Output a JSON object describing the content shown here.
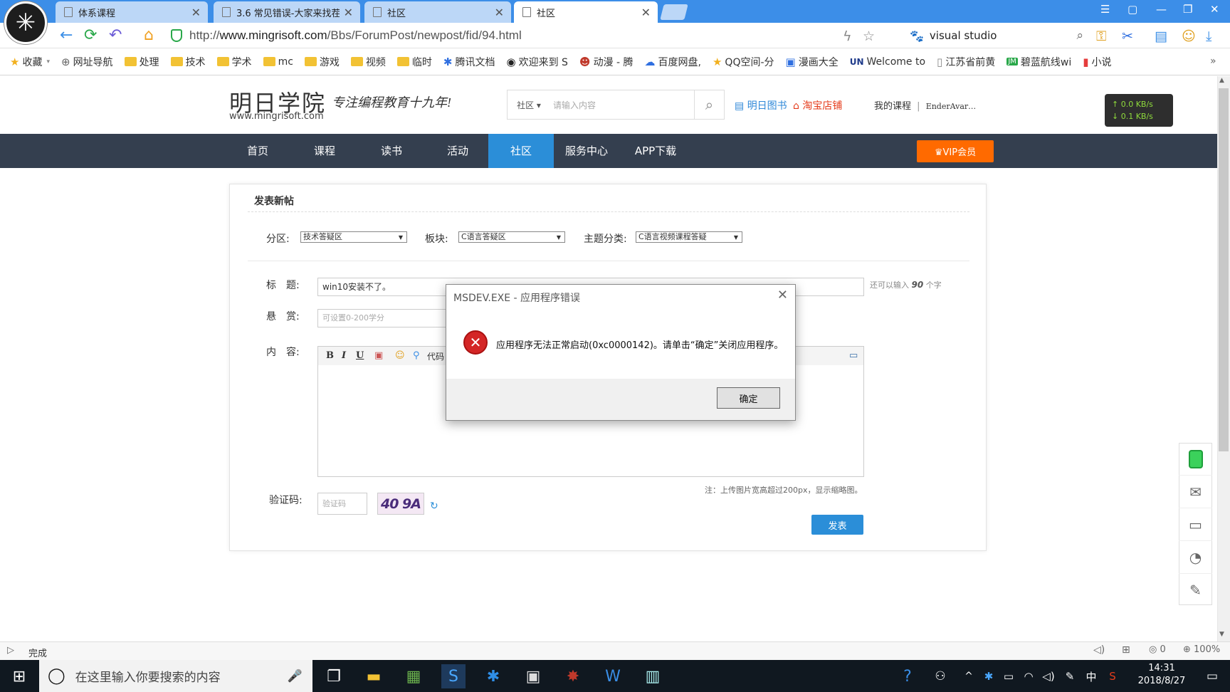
{
  "browser": {
    "tabs": [
      {
        "label": "体系课程"
      },
      {
        "label": "3.6 常见错误-大家来找茬"
      },
      {
        "label": "社区"
      },
      {
        "label": "社区"
      }
    ],
    "url_prefix": "http://",
    "url_domain": "www.mingrisoft.com",
    "url_path": "/Bbs/ForumPost/newpost/fid/94.html",
    "search_text": "visual studio",
    "bookmarks": [
      "收藏",
      "网址导航",
      "处理",
      "技术",
      "学术",
      "mc",
      "游戏",
      "视频",
      "临时",
      "腾讯文档",
      "欢迎来到 S",
      "动漫 - 腾",
      "百度网盘,",
      "QQ空间-分",
      "漫画大全",
      "Welcome to",
      "江苏省前黄",
      "碧蓝航线wi",
      "小说"
    ],
    "status_text": "完成",
    "zoom": "100%",
    "count_zero": "0"
  },
  "site": {
    "logo": "明日学院",
    "logo_url": "www.mingrisoft.com",
    "slogan": "专注编程教育十九年!",
    "search_category": "社区",
    "search_placeholder": "请输入内容",
    "books_link": "明日图书",
    "taobao_link": "淘宝店铺",
    "my_course": "我的课程",
    "username": "EnderAvar…",
    "speed_up": "↑ 0.0 KB/s",
    "speed_down": "↓ 0.1 KB/s",
    "nav": [
      "首页",
      "课程",
      "读书",
      "活动",
      "社区",
      "服务中心",
      "APP下载"
    ],
    "vip": "♛VIP会员"
  },
  "form": {
    "title": "发表新帖",
    "zone_label": "分区:",
    "zone_value": "技术答疑区",
    "board_label": "板块:",
    "board_value": "C语言答疑区",
    "topic_label": "主题分类:",
    "topic_value": "C语言视频课程答疑",
    "subject_label": "标　题:",
    "subject_value": "win10安装不了。",
    "subject_hint_pre": "还可以输入",
    "subject_hint_num": "90",
    "subject_hint_post": "个字",
    "reward_label": "悬　赏:",
    "reward_placeholder": "可设置0-200学分",
    "content_label": "内　容:",
    "code_btn": "代码",
    "image_note": "注：上传图片宽高超过200px，显示缩略图。",
    "captcha_label": "验证码:",
    "captcha_placeholder": "验证码",
    "captcha_text": "40 9A",
    "submit": "发表"
  },
  "dialog": {
    "title": "MSDEV.EXE - 应用程序错误",
    "message": "应用程序无法正常启动(0xc0000142)。请单击“确定”关闭应用程序。",
    "ok": "确定"
  },
  "taskbar": {
    "search_placeholder": "在这里输入你要搜索的内容",
    "time": "14:31",
    "date": "2018/8/27",
    "ime": "中"
  }
}
